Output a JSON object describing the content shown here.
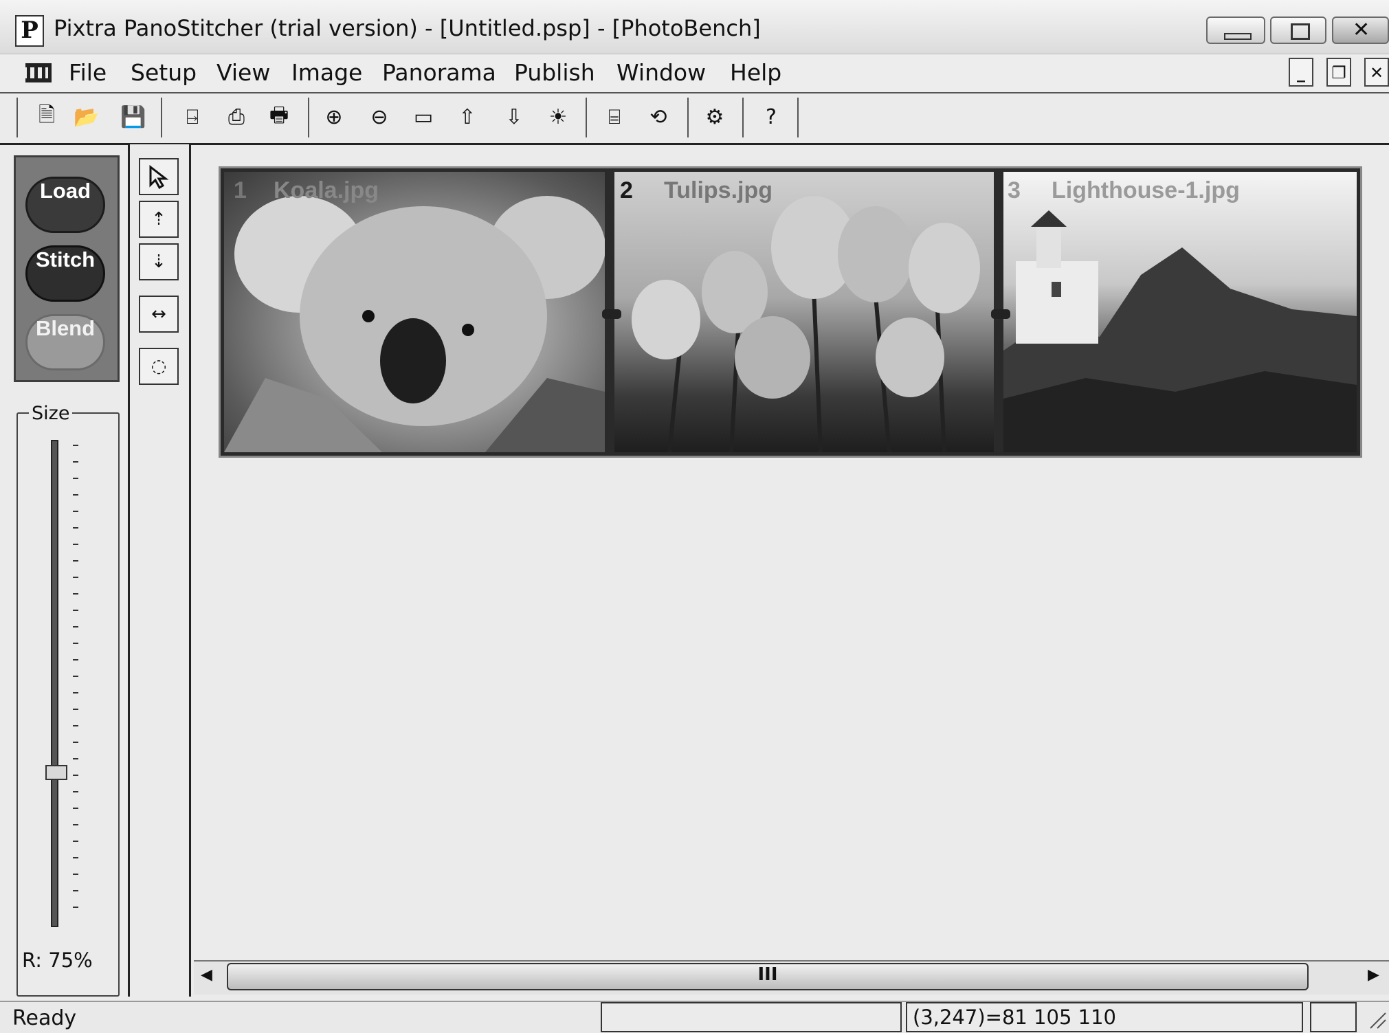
{
  "window": {
    "title": "Pixtra PanoStitcher (trial version) - [Untitled.psp] - [PhotoBench]"
  },
  "menu": {
    "items": [
      "File",
      "Setup",
      "View",
      "Image",
      "Panorama",
      "Publish",
      "Window",
      "Help"
    ]
  },
  "actions": {
    "load": "Load",
    "stitch": "Stitch",
    "blend": "Blend"
  },
  "size_panel": {
    "label": "Size",
    "ratio": "R: 75%",
    "slider_level_percent": 68
  },
  "images": [
    {
      "index": "1",
      "name": "Koala.jpg"
    },
    {
      "index": "2",
      "name": "Tulips.jpg"
    },
    {
      "index": "3",
      "name": "Lighthouse-1.jpg"
    }
  ],
  "scrollbar": {
    "thumb_glyph": "III"
  },
  "status": {
    "text": "Ready",
    "pixel_info": "(3,247)=81 105 110"
  },
  "icons": [
    "new-icon",
    "open-icon",
    "save-icon",
    "import-icon",
    "export-icon",
    "print-icon",
    "zoom-in-icon",
    "zoom-out-icon",
    "fit-icon",
    "move-up-icon",
    "move-down-icon",
    "brightness-icon",
    "stitch-icon",
    "rotate-icon",
    "settings-icon",
    "help-icon"
  ]
}
